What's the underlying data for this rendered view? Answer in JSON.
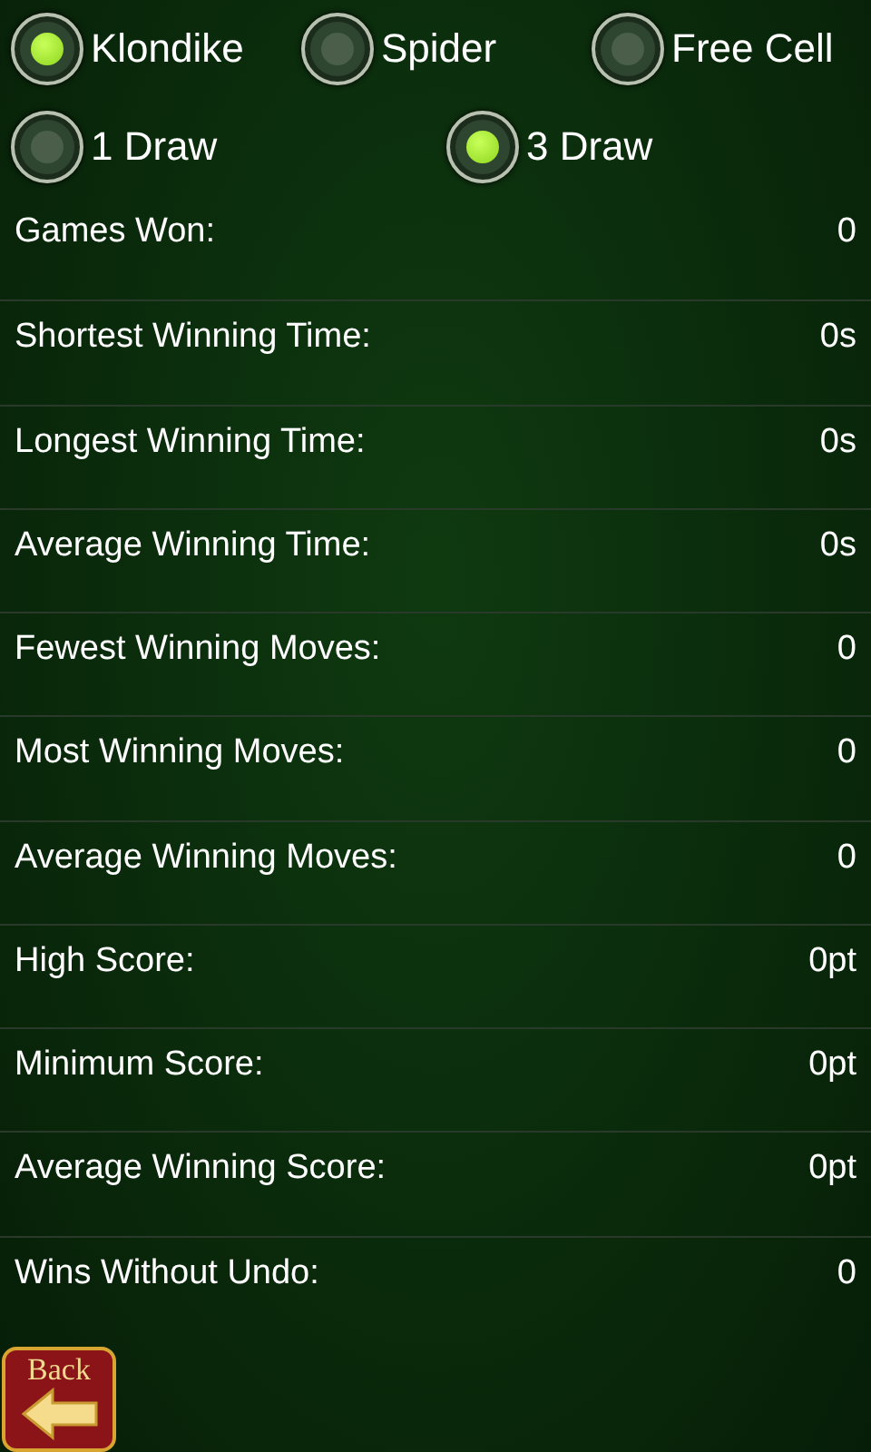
{
  "game_types": [
    {
      "label": "Klondike",
      "selected": true
    },
    {
      "label": "Spider",
      "selected": false
    },
    {
      "label": "Free Cell",
      "selected": false
    }
  ],
  "draw_modes": [
    {
      "label": "1 Draw",
      "selected": false
    },
    {
      "label": "3 Draw",
      "selected": true
    }
  ],
  "stats": [
    {
      "label": "Games Won:",
      "value": "0"
    },
    {
      "label": "Shortest Winning Time:",
      "value": "0s"
    },
    {
      "label": "Longest Winning Time:",
      "value": "0s"
    },
    {
      "label": "Average Winning Time:",
      "value": "0s"
    },
    {
      "label": "Fewest Winning Moves:",
      "value": "0"
    },
    {
      "label": "Most Winning Moves:",
      "value": "0"
    },
    {
      "label": "Average Winning Moves:",
      "value": "0"
    },
    {
      "label": "High Score:",
      "value": "0pt"
    },
    {
      "label": "Minimum Score:",
      "value": "0pt"
    },
    {
      "label": "Average Winning Score:",
      "value": "0pt"
    },
    {
      "label": "Wins Without Undo:",
      "value": "0"
    }
  ],
  "back_button": {
    "label": "Back"
  }
}
